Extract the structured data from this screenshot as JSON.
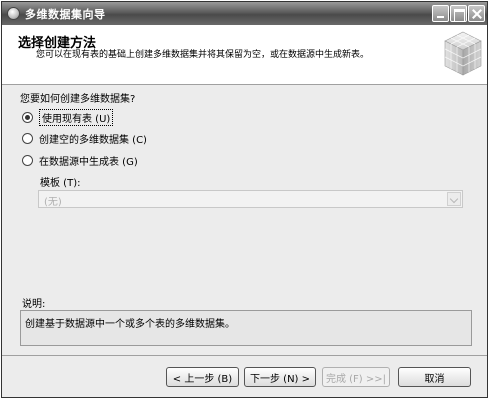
{
  "window": {
    "title": "多维数据集向导"
  },
  "header": {
    "title": "选择创建方法",
    "subtitle": "您可以在现有表的基础上创建多维数据集并将其保留为空，或在数据源中生成新表。"
  },
  "question": "您要如何创建多维数据集?",
  "options": [
    {
      "label": "使用现有表 (U)",
      "checked": true
    },
    {
      "label": "创建空的多维数据集 (C)",
      "checked": false
    },
    {
      "label": "在数据源中生成表 (G)",
      "checked": false
    }
  ],
  "template": {
    "label": "模板 (T):",
    "value": "(无)",
    "enabled": false
  },
  "description": {
    "label": "说明:",
    "text": "创建基于数据源中一个或多个表的多维数据集。"
  },
  "buttons": {
    "prev": "< 上一步 (B)",
    "next": "下一步 (N) >",
    "finish": "完成 (F) >>|",
    "cancel": "取消"
  }
}
